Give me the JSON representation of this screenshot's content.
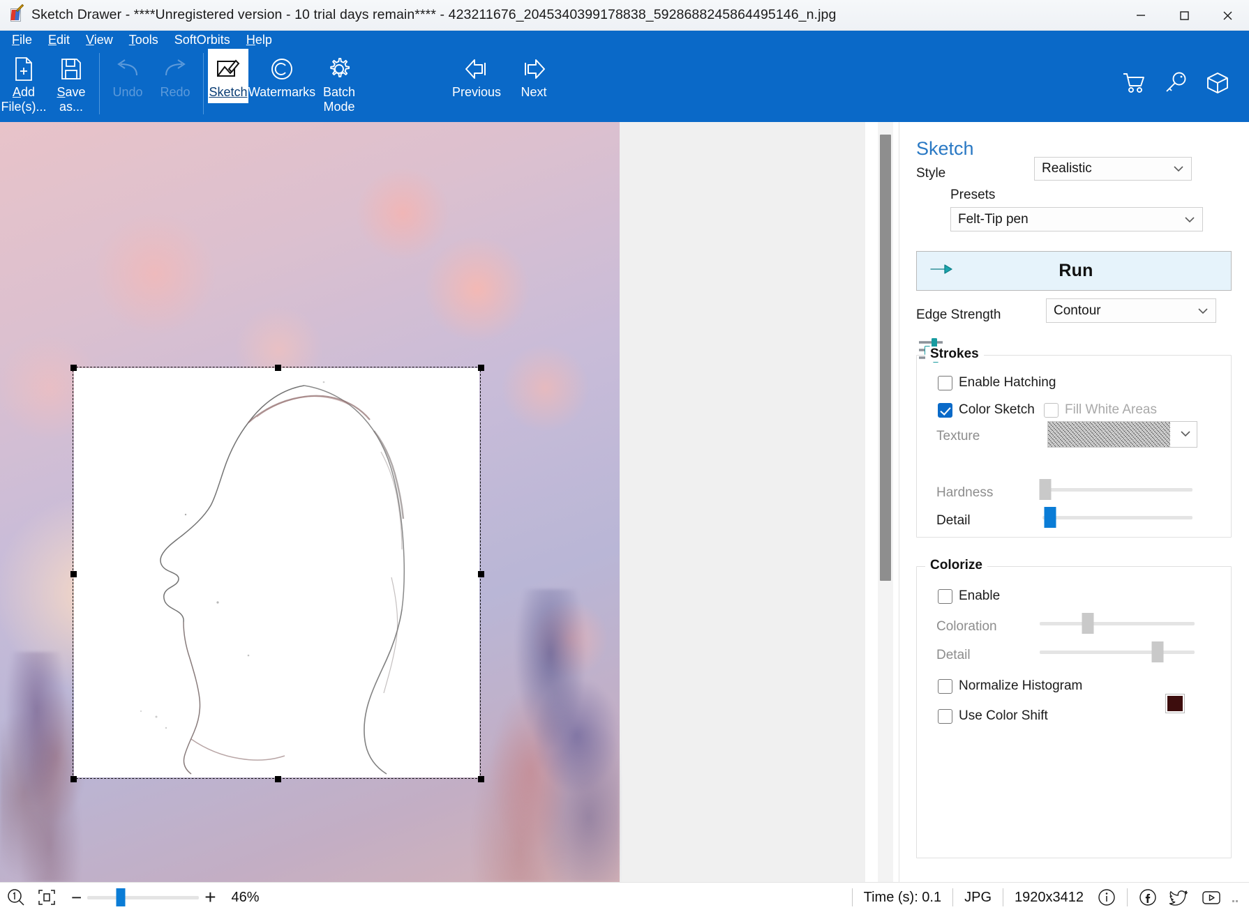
{
  "window": {
    "title": "Sketch Drawer - ****Unregistered version - 10 trial days remain**** - 423211676_2045340399178838_5928688245864495146_n.jpg",
    "app_icon": "sketch-drawer-icon",
    "minimize": "—",
    "maximize": "□",
    "close": "✕"
  },
  "menubar": {
    "items": [
      {
        "label": "File",
        "mnemonic": "F"
      },
      {
        "label": "Edit",
        "mnemonic": "E"
      },
      {
        "label": "View",
        "mnemonic": "V"
      },
      {
        "label": "Tools",
        "mnemonic": "T"
      },
      {
        "label": "SoftOrbits",
        "mnemonic": ""
      },
      {
        "label": "Help",
        "mnemonic": "H"
      }
    ]
  },
  "toolbar": {
    "buttons": [
      {
        "label": "Add\nFile(s)...",
        "icon": "add-file-icon",
        "state": "enabled"
      },
      {
        "label": "Save\nas...",
        "icon": "save-icon",
        "state": "enabled"
      },
      {
        "label": "Undo",
        "icon": "undo-icon",
        "state": "disabled"
      },
      {
        "label": "Redo",
        "icon": "redo-icon",
        "state": "disabled"
      },
      {
        "label": "Sketch",
        "icon": "sketch-icon",
        "state": "active"
      },
      {
        "label": "Watermarks",
        "icon": "copyright-icon",
        "state": "enabled"
      },
      {
        "label": "Batch\nMode",
        "icon": "gear-icon",
        "state": "enabled"
      },
      {
        "label": "Previous",
        "icon": "arrow-left-icon",
        "state": "enabled"
      },
      {
        "label": "Next",
        "icon": "arrow-right-icon",
        "state": "enabled"
      }
    ],
    "right_icons": [
      {
        "name": "cart-icon"
      },
      {
        "name": "key-icon"
      },
      {
        "name": "box-icon"
      }
    ]
  },
  "panel": {
    "title": "Sketch",
    "style_label": "Style",
    "style_value": "Realistic",
    "presets_label": "Presets",
    "presets_value": "Felt-Tip pen",
    "presets_icon": "sliders-icon",
    "run_label": "Run",
    "run_icon": "arrow-right-thick-icon",
    "edge_strength_label": "Edge Strength",
    "edge_strength_value": "Contour",
    "strokes": {
      "group_title": "Strokes",
      "enable_hatching_label": "Enable Hatching",
      "enable_hatching_checked": false,
      "color_sketch_label": "Color Sketch",
      "color_sketch_checked": true,
      "fill_white_areas_label": "Fill White Areas",
      "fill_white_areas_checked": false,
      "fill_white_areas_disabled": true,
      "texture_label": "Texture",
      "texture_value": "pencil-hatch-texture",
      "hardness_label": "Hardness",
      "hardness_value": 2,
      "hardness_disabled": true,
      "detail_label": "Detail",
      "detail_value": 5
    },
    "colorize": {
      "group_title": "Colorize",
      "enable_label": "Enable",
      "enable_checked": false,
      "coloration_label": "Coloration",
      "coloration_value": 31,
      "detail_label": "Detail",
      "detail_value": 76,
      "normalize_histogram_label": "Normalize Histogram",
      "normalize_histogram_checked": false,
      "use_color_shift_label": "Use Color Shift",
      "use_color_shift_checked": false,
      "color_swatch": "#3d0d0d"
    }
  },
  "statusbar": {
    "zoom_one_to_one_icon": "zoom-actual-size-icon",
    "fit_icon": "fit-to-window-icon",
    "zoom_out_label": "−",
    "zoom_in_label": "+",
    "zoom_percent": "46%",
    "zoom_slider_value": 30,
    "time_label": "Time (s): 0.1",
    "format_label": "JPG",
    "dimensions_label": "1920x3412",
    "icons": [
      {
        "name": "info-icon"
      },
      {
        "name": "facebook-icon"
      },
      {
        "name": "twitter-icon"
      },
      {
        "name": "youtube-icon"
      }
    ]
  }
}
